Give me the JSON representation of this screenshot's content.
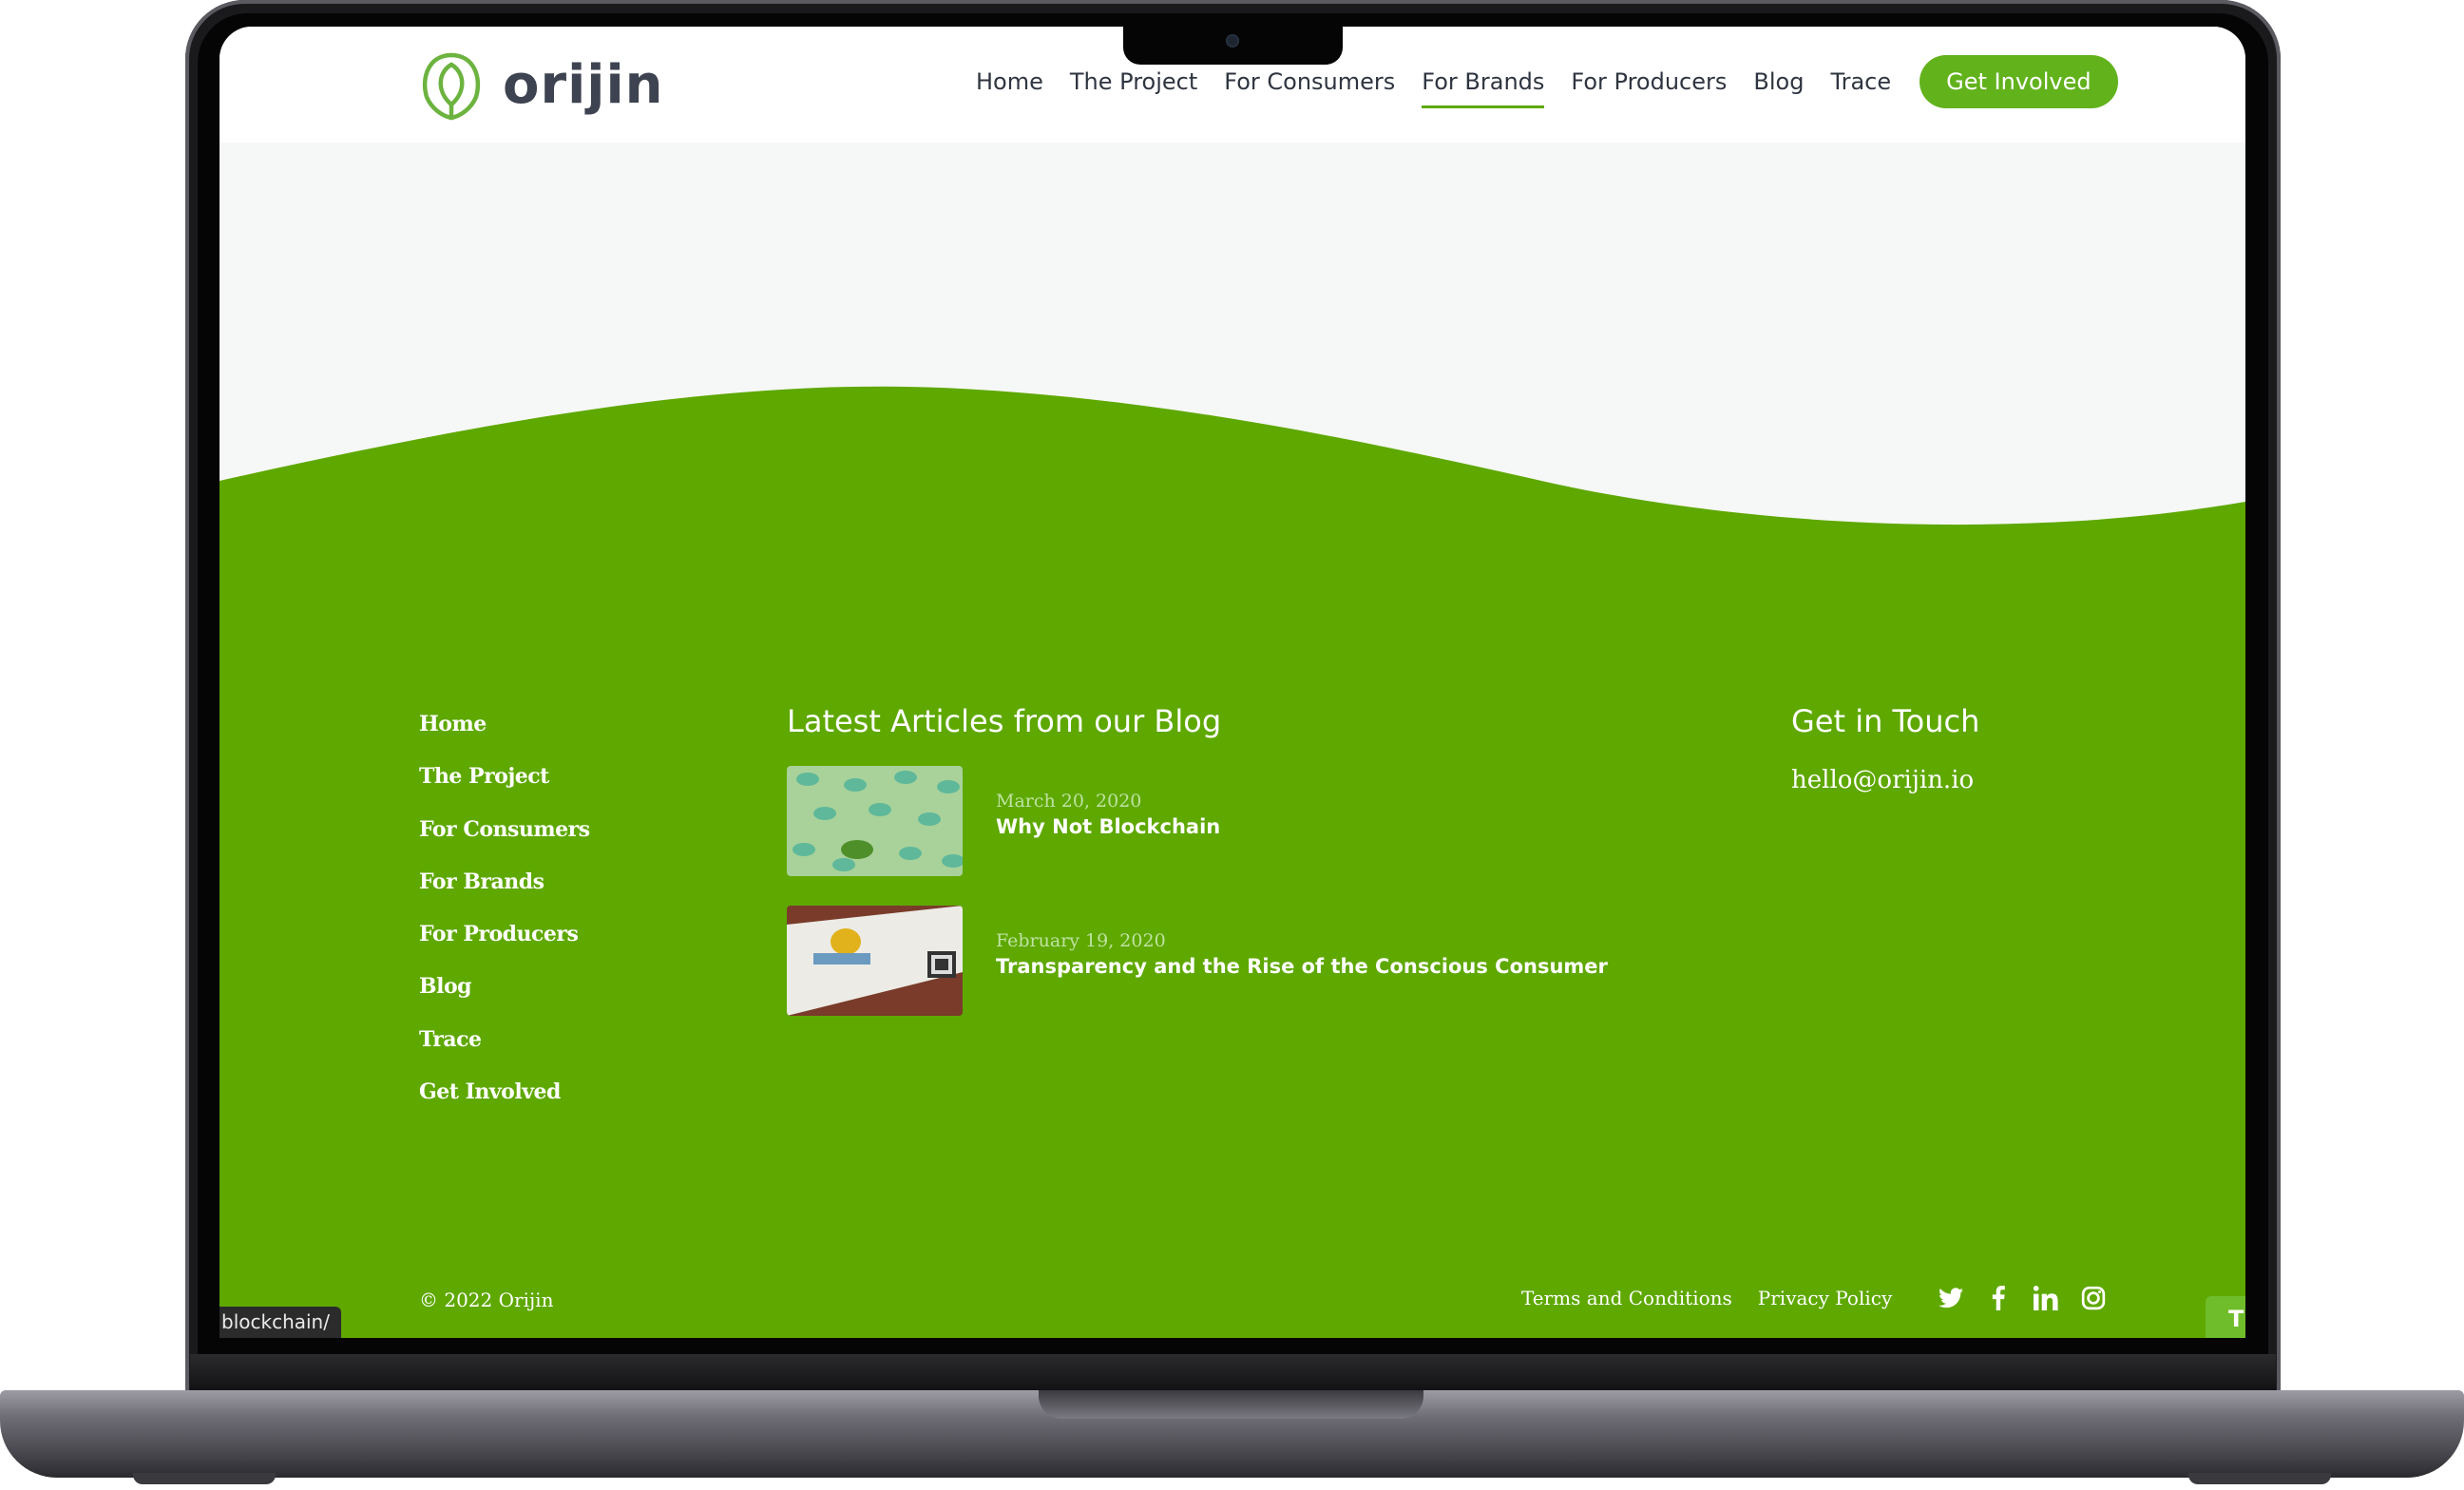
{
  "colors": {
    "brand_green": "#5ea800",
    "button_green": "#62b21c",
    "page_bg": "#f6f7f7",
    "text_dark": "#2f3540"
  },
  "header": {
    "logo_text": "orijin",
    "logo_icon": "leaf-icon",
    "nav": [
      {
        "label": "Home",
        "active": false
      },
      {
        "label": "The Project",
        "active": false
      },
      {
        "label": "For Consumers",
        "active": false
      },
      {
        "label": "For Brands",
        "active": true
      },
      {
        "label": "For Producers",
        "active": false
      },
      {
        "label": "Blog",
        "active": false
      },
      {
        "label": "Trace",
        "active": false
      }
    ],
    "cta_label": "Get Involved"
  },
  "footer": {
    "links": [
      "Home",
      "The Project",
      "For Consumers",
      "For Brands",
      "For Producers",
      "Blog",
      "Trace",
      "Get Involved"
    ],
    "blog": {
      "title": "Latest Articles from our Blog",
      "articles": [
        {
          "date": "March 20, 2020",
          "title": "Why Not Blockchain"
        },
        {
          "date": "February 19, 2020",
          "title": "Transparency and the Rise of the Conscious Consumer"
        }
      ]
    },
    "contact": {
      "title": "Get in Touch",
      "email": "hello@orijin.io"
    },
    "copyright": "© 2022 Orijin",
    "legal": [
      "Terms and Conditions",
      "Privacy Policy"
    ],
    "social_icons": [
      "twitter-icon",
      "facebook-icon",
      "linkedin-icon",
      "instagram-icon"
    ]
  },
  "status_bar": {
    "url_fragment": "blockchain/"
  },
  "edge_button": {
    "label": "T"
  }
}
